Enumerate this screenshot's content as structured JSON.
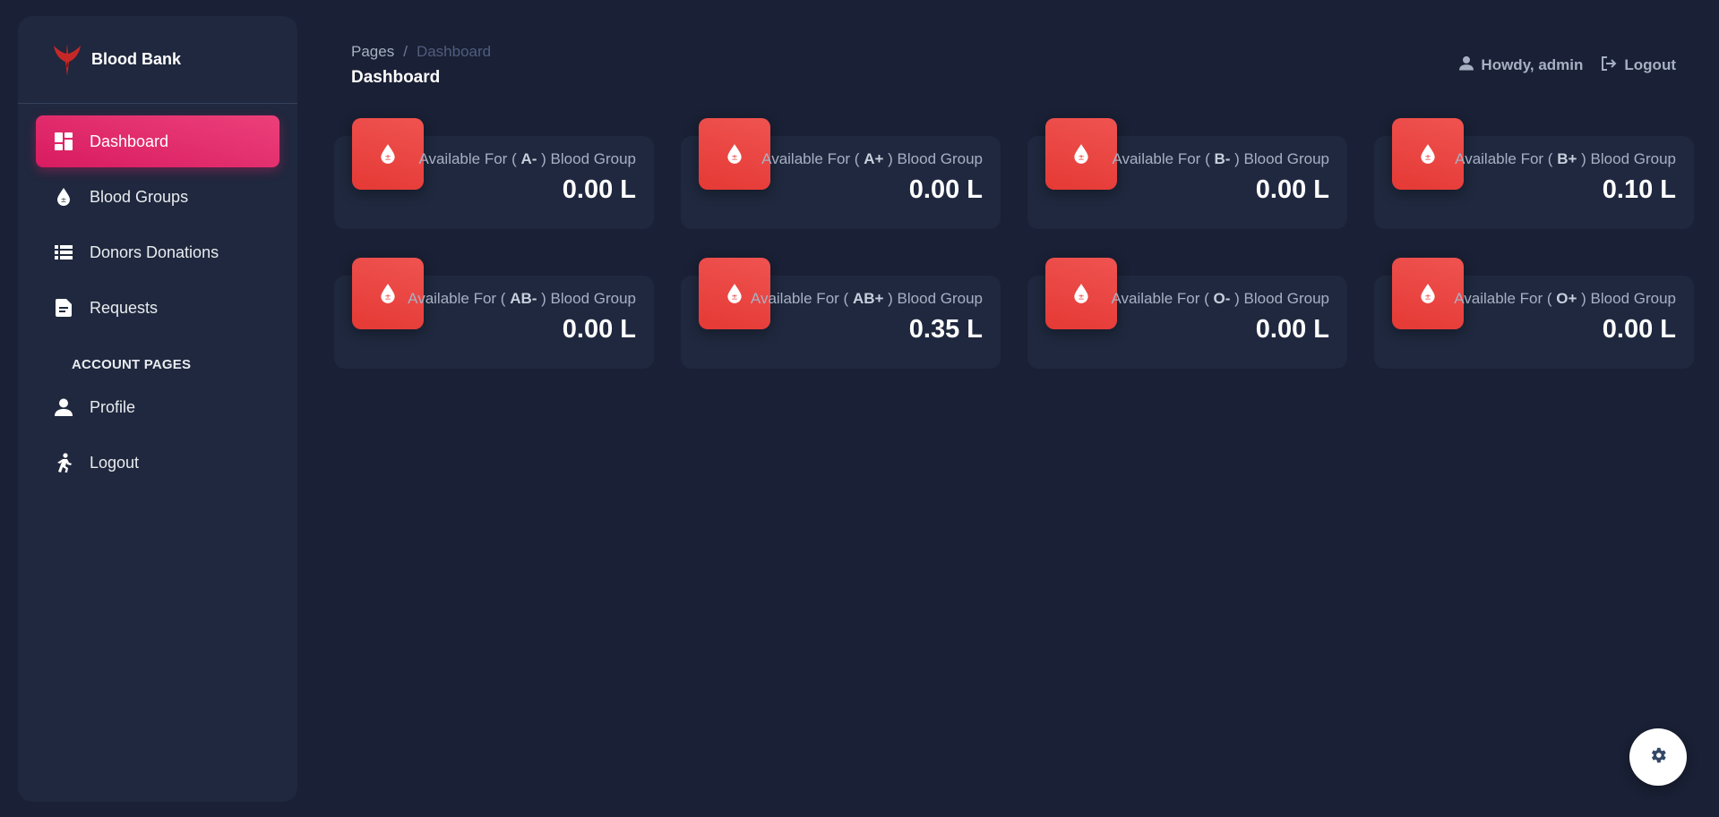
{
  "brand": {
    "name": "Blood Bank",
    "logo_icon": "phoenix-logo-icon"
  },
  "sidebar": {
    "items": [
      {
        "label": "Dashboard",
        "icon": "dashboard-icon",
        "active": true
      },
      {
        "label": "Blood Groups",
        "icon": "blood-drop-icon",
        "active": false
      },
      {
        "label": "Donors Donations",
        "icon": "list-icon",
        "active": false
      },
      {
        "label": "Requests",
        "icon": "document-icon",
        "active": false
      }
    ],
    "section_title": "ACCOUNT PAGES",
    "account_items": [
      {
        "label": "Profile",
        "icon": "person-icon"
      },
      {
        "label": "Logout",
        "icon": "run-icon"
      }
    ]
  },
  "header": {
    "breadcrumb_root": "Pages",
    "breadcrumb_sep": "/",
    "breadcrumb_current": "Dashboard",
    "title": "Dashboard",
    "user_greeting": "Howdy, admin",
    "logout_label": "Logout"
  },
  "cards": [
    {
      "prefix": "Available For (",
      "group": "A-",
      "suffix": ") Blood Group",
      "value": "0.00 L"
    },
    {
      "prefix": "Available For (",
      "group": "A+",
      "suffix": ") Blood Group",
      "value": "0.00 L"
    },
    {
      "prefix": "Available For (",
      "group": "B-",
      "suffix": ") Blood Group",
      "value": "0.00 L"
    },
    {
      "prefix": "Available For (",
      "group": "B+",
      "suffix": ") Blood Group",
      "value": "0.10 L"
    },
    {
      "prefix": "Available For (",
      "group": "AB-",
      "suffix": ") Blood Group",
      "value": "0.00 L"
    },
    {
      "prefix": "Available For (",
      "group": "AB+",
      "suffix": ") Blood Group",
      "value": "0.35 L"
    },
    {
      "prefix": "Available For (",
      "group": "O-",
      "suffix": ") Blood Group",
      "value": "0.00 L"
    },
    {
      "prefix": "Available For (",
      "group": "O+",
      "suffix": ") Blood Group",
      "value": "0.00 L"
    }
  ],
  "colors": {
    "background": "#1a2035",
    "panel": "#1f283e",
    "accent_pink": "#e91e63",
    "card_icon_red": "#e53935"
  },
  "fab": {
    "icon": "gear-icon"
  }
}
